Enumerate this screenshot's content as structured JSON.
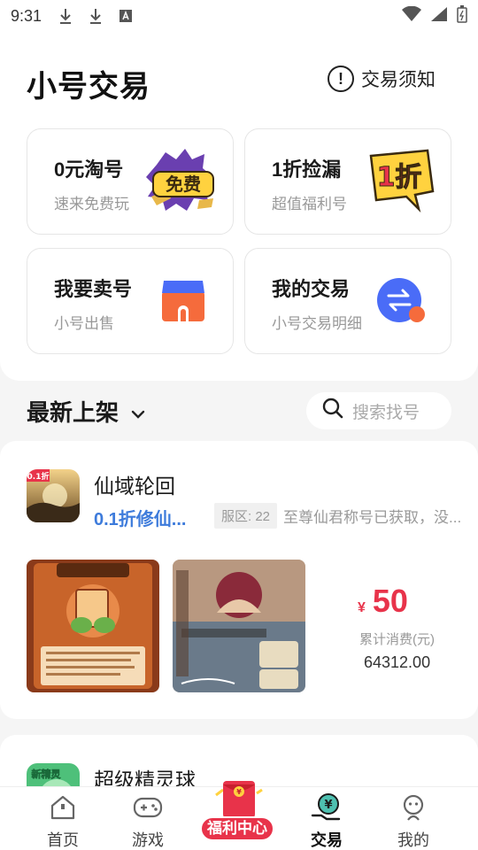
{
  "status_bar": {
    "time": "9:31"
  },
  "header": {
    "title": "小号交易",
    "notice_label": "交易须知"
  },
  "cards": [
    {
      "title": "0元淘号",
      "subtitle": "速来免费玩",
      "icon_text": "免费",
      "icon": "free-badge-icon"
    },
    {
      "title": "1折捡漏",
      "subtitle": "超值福利号",
      "icon_text": "1折",
      "icon": "discount-badge-icon"
    },
    {
      "title": "我要卖号",
      "subtitle": "小号出售",
      "icon": "store-icon"
    },
    {
      "title": "我的交易",
      "subtitle": "小号交易明细",
      "icon": "exchange-icon"
    }
  ],
  "latest": {
    "title": "最新上架",
    "search_placeholder": "搜索找号"
  },
  "listings": [
    {
      "name": "仙域轮回",
      "icon_badge": "0.1折",
      "promo": "0.1折修仙...",
      "server": "服区: 22",
      "description": "至尊仙君称号已获取，没...",
      "currency": "¥",
      "price": "50",
      "spend_label": "累计消费(元)",
      "spend_value": "64312.00"
    },
    {
      "name": "超级精灵球",
      "icon_badge": "新精灵"
    }
  ],
  "tabs": [
    {
      "label": "首页",
      "icon": "home-icon"
    },
    {
      "label": "游戏",
      "icon": "gamepad-icon"
    },
    {
      "label": "福利中心",
      "icon": "red-envelope-icon"
    },
    {
      "label": "交易",
      "icon": "trade-hand-icon",
      "active": true
    },
    {
      "label": "我的",
      "icon": "profile-icon"
    }
  ],
  "colors": {
    "accent_red": "#e8334a",
    "promo_blue": "#3d7bdb",
    "exchange_blue": "#4a6cf7",
    "store_orange": "#f56b3c"
  }
}
